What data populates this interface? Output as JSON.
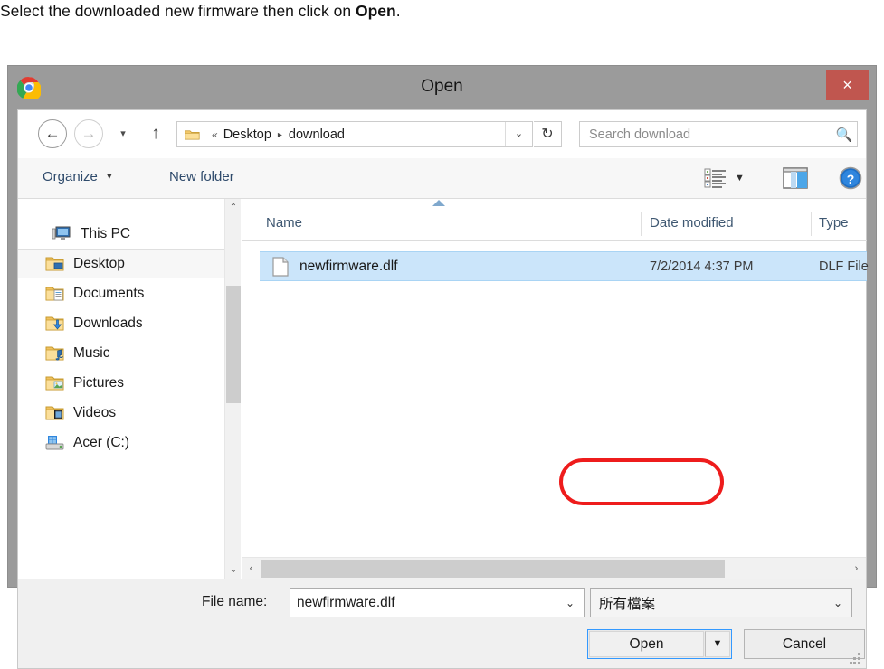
{
  "caption": {
    "text_before": "Select the downloaded new firmware then click on ",
    "text_bold": "Open",
    "text_after": "."
  },
  "window": {
    "title": "Open",
    "app_icon": "chrome-icon",
    "close_label": "×",
    "close_color": "#c0564f",
    "titlebar_color": "#9b9b9b"
  },
  "nav": {
    "back_label": "←",
    "forward_label": "→",
    "recent_label": "▾",
    "up_label": "↑",
    "refresh_label": "↻",
    "address_dropdown_label": "⌄",
    "breadcrumb": {
      "prefix": "«",
      "items": [
        "Desktop",
        "download"
      ],
      "separator": "▸"
    }
  },
  "search": {
    "placeholder": "Search download",
    "value": "",
    "icon": "search-icon"
  },
  "toolbar": {
    "organize_label": "Organize",
    "organize_caret": "▼",
    "new_folder_label": "New folder",
    "view_mode_caret": "▼",
    "icons": [
      "view-mode-icon",
      "preview-pane-icon",
      "help-icon"
    ]
  },
  "sidebar": {
    "scroll_up": "⌃",
    "scroll_down": "⌄",
    "items": [
      {
        "label": "This PC",
        "icon": "computer-icon",
        "selected": false,
        "root": true
      },
      {
        "label": "Desktop",
        "icon": "folder-desktop-icon",
        "selected": true,
        "root": false
      },
      {
        "label": "Documents",
        "icon": "folder-documents-icon",
        "selected": false,
        "root": false
      },
      {
        "label": "Downloads",
        "icon": "folder-downloads-icon",
        "selected": false,
        "root": false
      },
      {
        "label": "Music",
        "icon": "folder-music-icon",
        "selected": false,
        "root": false
      },
      {
        "label": "Pictures",
        "icon": "folder-pictures-icon",
        "selected": false,
        "root": false
      },
      {
        "label": "Videos",
        "icon": "folder-videos-icon",
        "selected": false,
        "root": false
      },
      {
        "label": "Acer (C:)",
        "icon": "hard-drive-icon",
        "selected": false,
        "root": false
      }
    ]
  },
  "file_list": {
    "columns": [
      "Name",
      "Date modified",
      "Type"
    ],
    "sort_column": "Name",
    "sort_direction": "ascending",
    "rows": [
      {
        "name": "newfirmware.dlf",
        "date_modified": "7/2/2014 4:37 PM",
        "type": "DLF File",
        "icon": "file-generic-icon",
        "selected": true
      }
    ],
    "hscroll_left": "‹",
    "hscroll_right": "›"
  },
  "footer": {
    "file_name_label": "File name:",
    "file_name_value": "newfirmware.dlf",
    "file_name_caret": "⌄",
    "file_type_value": "所有檔案",
    "file_type_caret": "⌄",
    "open_label": "Open",
    "open_split_caret": "▼",
    "cancel_label": "Cancel"
  },
  "annotation": {
    "highlight_target": "Open",
    "highlight_color": "#ee1c1c"
  }
}
